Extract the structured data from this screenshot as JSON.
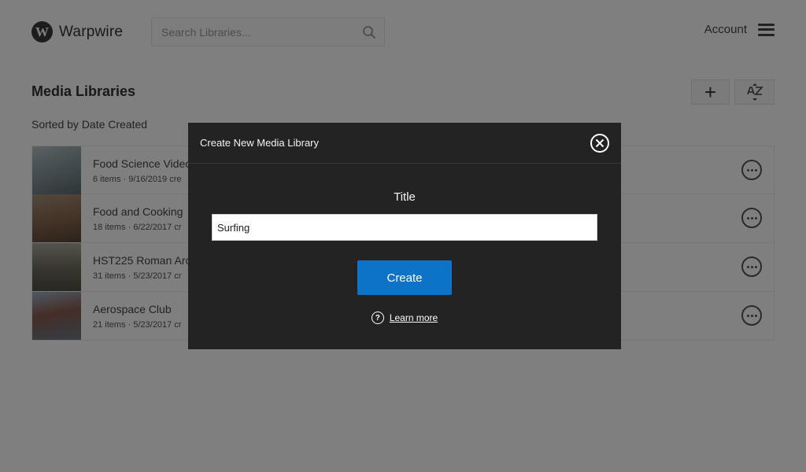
{
  "header": {
    "logo_letter": "W",
    "logo_text": "Warpwire",
    "search_placeholder": "Search Libraries...",
    "account_label": "Account"
  },
  "page": {
    "title": "Media Libraries",
    "sort_label": "Sorted by Date Created",
    "add_label": "+",
    "sort_icon": "az-sort-icon"
  },
  "libraries": [
    {
      "title": "Food Science Video",
      "meta": "6 items · 9/16/2019 cre",
      "thumb_color": "#8a9aa0"
    },
    {
      "title": "Food and Cooking",
      "meta": "18 items · 6/22/2017 cr",
      "thumb_color": "#8b6a52"
    },
    {
      "title": "HST225 Roman Arc",
      "meta": "31 items · 5/23/2017 cr",
      "thumb_color": "#6e6a5a"
    },
    {
      "title": "Aerospace Club",
      "meta": "21 items · 5/23/2017 cr",
      "thumb_color": "#6d7c88"
    }
  ],
  "modal": {
    "title": "Create New Media Library",
    "field_label": "Title",
    "field_value": "Surfing",
    "create_label": "Create",
    "help_glyph": "?",
    "learn_more_label": "Learn more"
  },
  "colors": {
    "accent": "#0d73c7",
    "modal_bg": "#232323"
  }
}
